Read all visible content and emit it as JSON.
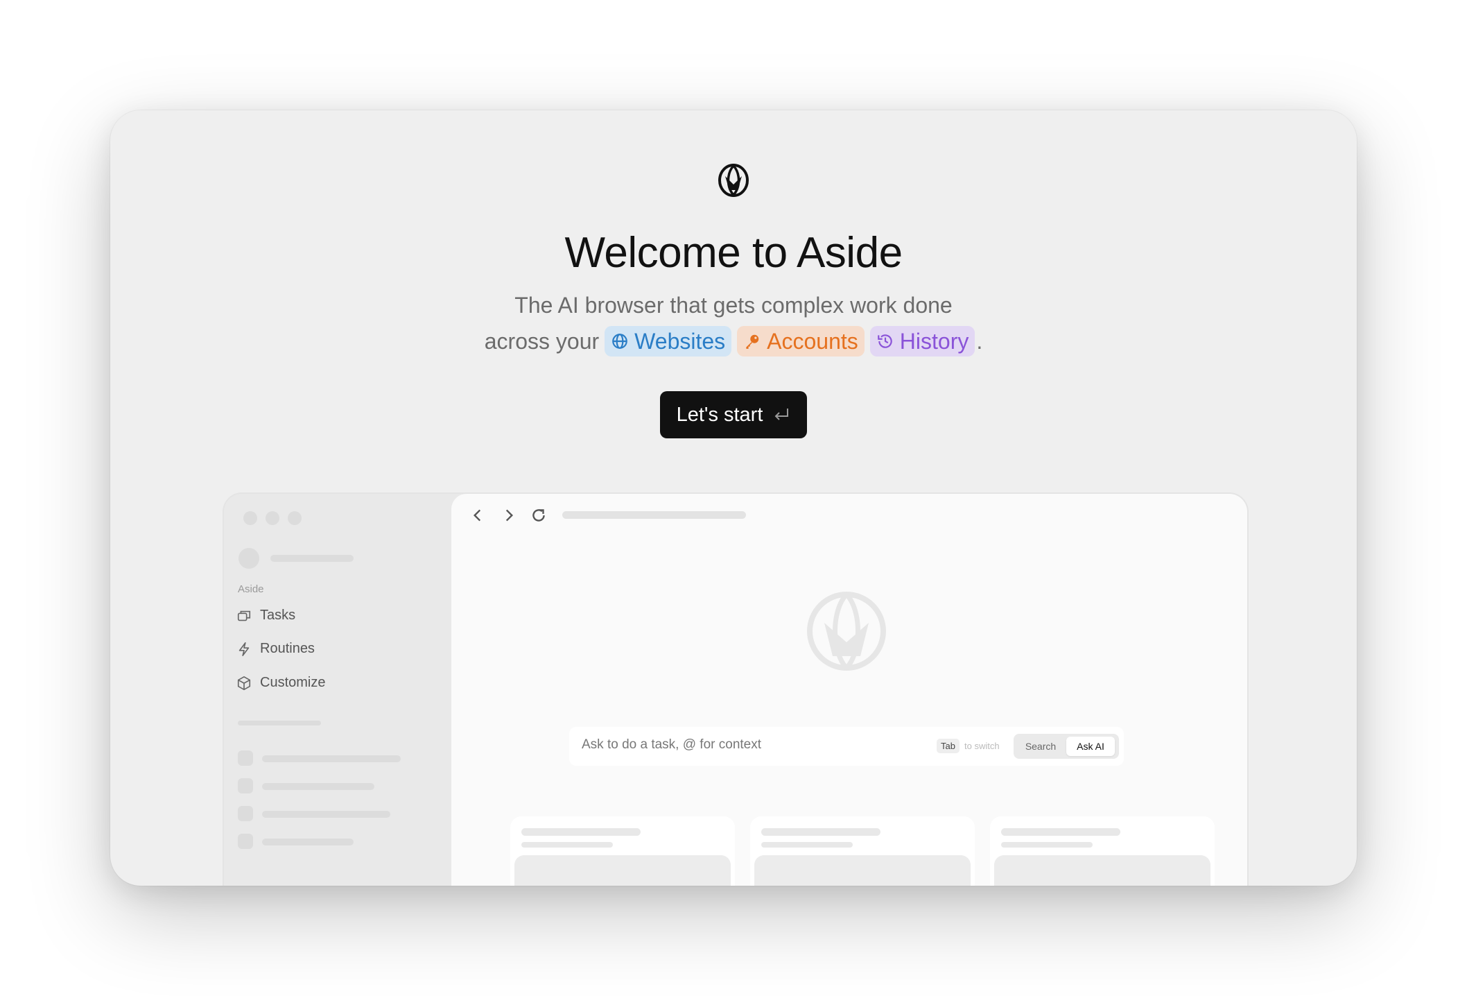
{
  "welcome": {
    "title": "Welcome to Aside",
    "subtitle_line1": "The AI browser that gets complex work done",
    "subtitle_prefix": "across your",
    "chips": [
      {
        "label": "Websites",
        "icon": "globe-icon",
        "color": "#2a7dc6"
      },
      {
        "label": "Accounts",
        "icon": "key-icon",
        "color": "#e5711f"
      },
      {
        "label": "History",
        "icon": "history-icon",
        "color": "#8a53d8"
      }
    ],
    "period": ".",
    "start_button": "Let's start"
  },
  "preview": {
    "sidebar": {
      "section_label": "Aside",
      "items": [
        {
          "label": "Tasks",
          "icon": "tasks-icon"
        },
        {
          "label": "Routines",
          "icon": "routines-icon"
        },
        {
          "label": "Customize",
          "icon": "cube-icon"
        }
      ]
    },
    "ask_bar": {
      "placeholder": "Ask to do a task, @ for context",
      "key_hint": "Tab",
      "key_hint_text": "to switch",
      "mode_options": [
        "Search",
        "Ask AI"
      ],
      "selected_mode": "Ask AI"
    }
  }
}
